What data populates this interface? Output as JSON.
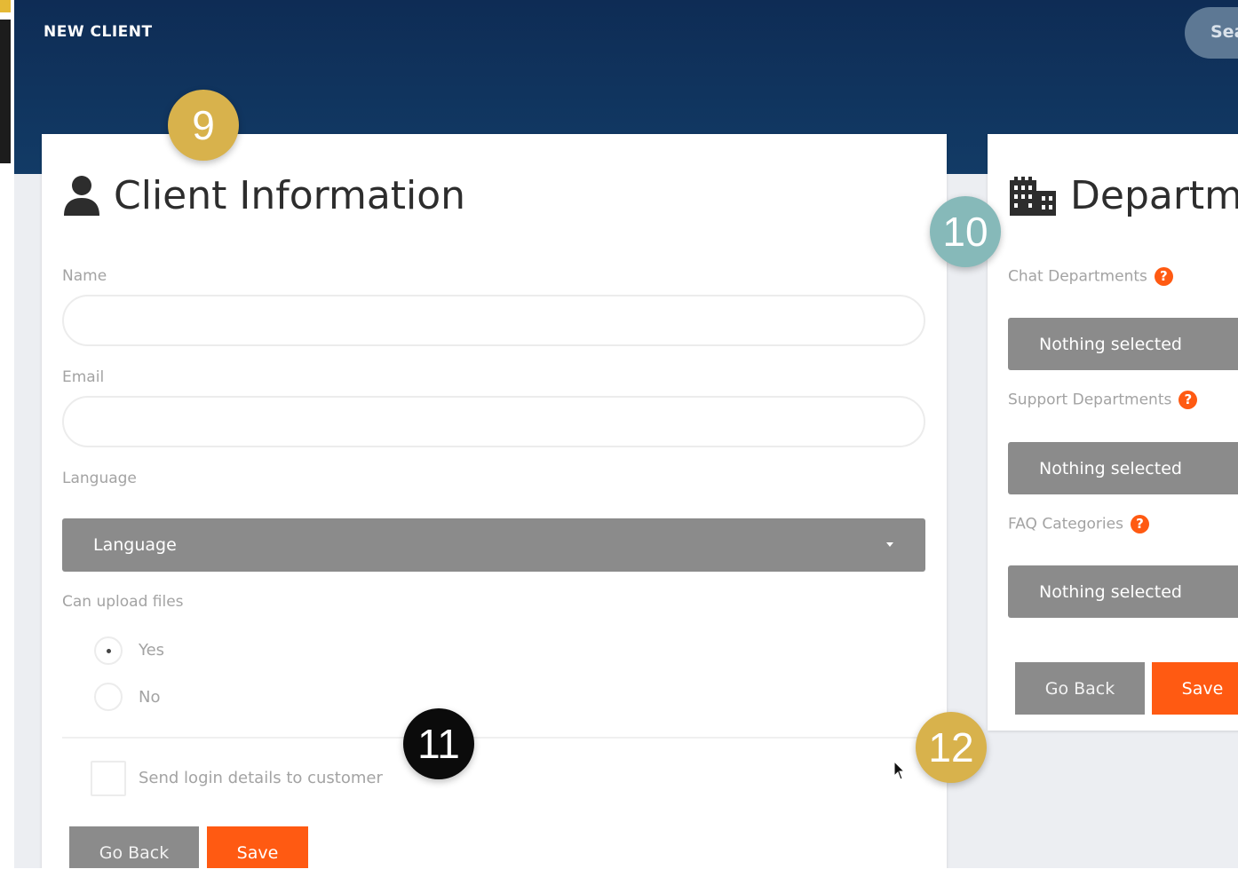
{
  "header": {
    "title": "NEW CLIENT",
    "search_label": "Sea"
  },
  "client_info": {
    "title": "Client Information",
    "name_label": "Name",
    "name_value": "",
    "email_label": "Email",
    "email_value": "",
    "language_label": "Language",
    "language_selected": "Language",
    "upload_label": "Can upload files",
    "upload_options": [
      "Yes",
      "No"
    ],
    "upload_selected": "Yes",
    "send_login_label": "Send login details to customer",
    "send_login_checked": false,
    "go_back_label": "Go Back",
    "save_label": "Save"
  },
  "departments": {
    "title": "Departm",
    "chat_label": "Chat Departments",
    "chat_selected": "Nothing selected",
    "support_label": "Support Departments",
    "support_selected": "Nothing selected",
    "faq_label": "FAQ Categories",
    "faq_selected": "Nothing selected",
    "go_back_label": "Go Back",
    "save_label": "Save"
  },
  "badges": {
    "b9": "9",
    "b10": "10",
    "b11": "11",
    "b12": "12"
  },
  "colors": {
    "header": "#0e2c55",
    "accent_orange": "#ff5a12",
    "select_grey": "#8b8b8b",
    "badge_gold": "#d8b24c",
    "badge_teal": "#86b9b9",
    "badge_black": "#0b0b0b"
  },
  "icons": {
    "help": "question-circle-icon",
    "user": "user-icon",
    "building": "building-icon"
  }
}
